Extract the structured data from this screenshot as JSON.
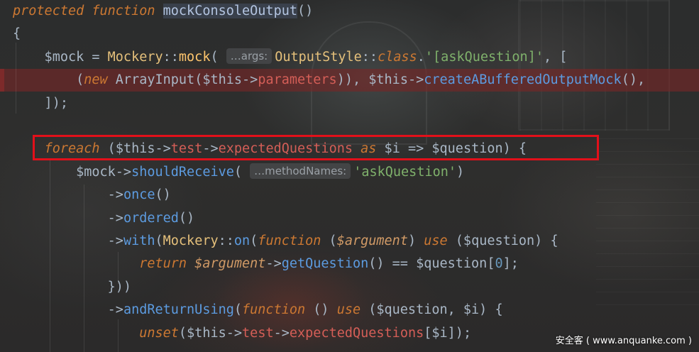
{
  "editor": {
    "lines": [
      {
        "tokens": [
          {
            "t": "protected",
            "c": "kw"
          },
          {
            "t": " ",
            "c": "plain"
          },
          {
            "t": "function",
            "c": "kw"
          },
          {
            "t": " ",
            "c": "plain"
          },
          {
            "t": "mockConsoleOutput",
            "c": "fnhl"
          },
          {
            "t": "()",
            "c": "plain"
          }
        ]
      },
      {
        "tokens": [
          {
            "t": "{",
            "c": "plain"
          }
        ]
      },
      {
        "tokens": [
          {
            "t": "    $mock = ",
            "c": "plain"
          },
          {
            "t": "Mockery",
            "c": "cls"
          },
          {
            "t": "::",
            "c": "plain"
          },
          {
            "t": "mock",
            "c": "fn"
          },
          {
            "t": "( ",
            "c": "plain"
          },
          {
            "t": "…args:",
            "c": "hint"
          },
          {
            "t": "OutputStyle",
            "c": "cls"
          },
          {
            "t": "::",
            "c": "plain"
          },
          {
            "t": "class",
            "c": "kw"
          },
          {
            "t": ".",
            "c": "plain"
          },
          {
            "t": "'[askQuestion]'",
            "c": "str"
          },
          {
            "t": ", [",
            "c": "plain"
          }
        ]
      },
      {
        "error": true,
        "tokens": [
          {
            "t": "        (",
            "c": "plain"
          },
          {
            "t": "new",
            "c": "kw"
          },
          {
            "t": " ArrayInput(",
            "c": "plain"
          },
          {
            "t": "$this",
            "c": "plain"
          },
          {
            "t": "->",
            "c": "plain"
          },
          {
            "t": "parameters",
            "c": "prop"
          },
          {
            "t": ")), ",
            "c": "plain"
          },
          {
            "t": "$this",
            "c": "plain"
          },
          {
            "t": "->",
            "c": "plain"
          },
          {
            "t": "createABufferedOutputMock",
            "c": "method"
          },
          {
            "t": "(),",
            "c": "plain"
          }
        ]
      },
      {
        "tokens": [
          {
            "t": "    ]);",
            "c": "plain"
          }
        ]
      },
      {
        "tokens": []
      },
      {
        "tokens": [
          {
            "t": "    ",
            "c": "plain"
          },
          {
            "t": "foreach",
            "c": "kw"
          },
          {
            "t": " (",
            "c": "plain"
          },
          {
            "t": "$this",
            "c": "plain"
          },
          {
            "t": "->",
            "c": "plain"
          },
          {
            "t": "test",
            "c": "prop"
          },
          {
            "t": "->",
            "c": "plain"
          },
          {
            "t": "expectedQuestions",
            "c": "prop"
          },
          {
            "t": " ",
            "c": "plain"
          },
          {
            "t": "as",
            "c": "kw"
          },
          {
            "t": " $i => $question) {",
            "c": "plain"
          }
        ]
      },
      {
        "tokens": [
          {
            "t": "        $mock->",
            "c": "plain"
          },
          {
            "t": "shouldReceive",
            "c": "method"
          },
          {
            "t": "( ",
            "c": "plain"
          },
          {
            "t": "…methodNames:",
            "c": "hint"
          },
          {
            "t": "'askQuestion'",
            "c": "str"
          },
          {
            "t": ")",
            "c": "plain"
          }
        ]
      },
      {
        "tokens": [
          {
            "t": "            ->",
            "c": "plain"
          },
          {
            "t": "once",
            "c": "method"
          },
          {
            "t": "()",
            "c": "plain"
          }
        ]
      },
      {
        "tokens": [
          {
            "t": "            ->",
            "c": "plain"
          },
          {
            "t": "ordered",
            "c": "method"
          },
          {
            "t": "()",
            "c": "plain"
          }
        ]
      },
      {
        "tokens": [
          {
            "t": "            ->",
            "c": "plain"
          },
          {
            "t": "with",
            "c": "method"
          },
          {
            "t": "(",
            "c": "plain"
          },
          {
            "t": "Mockery",
            "c": "cls"
          },
          {
            "t": "::",
            "c": "plain"
          },
          {
            "t": "on",
            "c": "method"
          },
          {
            "t": "(",
            "c": "plain"
          },
          {
            "t": "function",
            "c": "kw"
          },
          {
            "t": " (",
            "c": "plain"
          },
          {
            "t": "$argument",
            "c": "italicvar"
          },
          {
            "t": ") ",
            "c": "plain"
          },
          {
            "t": "use",
            "c": "kw"
          },
          {
            "t": " ($question) {",
            "c": "plain"
          }
        ]
      },
      {
        "tokens": [
          {
            "t": "                ",
            "c": "plain"
          },
          {
            "t": "return",
            "c": "kw"
          },
          {
            "t": " ",
            "c": "plain"
          },
          {
            "t": "$argument",
            "c": "italicvar"
          },
          {
            "t": "->",
            "c": "plain"
          },
          {
            "t": "getQuestion",
            "c": "method"
          },
          {
            "t": "() == $question[",
            "c": "plain"
          },
          {
            "t": "0",
            "c": "num"
          },
          {
            "t": "];",
            "c": "plain"
          }
        ]
      },
      {
        "tokens": [
          {
            "t": "            }))",
            "c": "plain"
          }
        ]
      },
      {
        "tokens": [
          {
            "t": "            ->",
            "c": "plain"
          },
          {
            "t": "andReturnUsing",
            "c": "method"
          },
          {
            "t": "(",
            "c": "plain"
          },
          {
            "t": "function",
            "c": "kw"
          },
          {
            "t": " () ",
            "c": "plain"
          },
          {
            "t": "use",
            "c": "kw"
          },
          {
            "t": " ($question, $i) {",
            "c": "plain"
          }
        ]
      },
      {
        "tokens": [
          {
            "t": "                ",
            "c": "plain"
          },
          {
            "t": "unset",
            "c": "kw"
          },
          {
            "t": "(",
            "c": "plain"
          },
          {
            "t": "$this",
            "c": "plain"
          },
          {
            "t": "->",
            "c": "plain"
          },
          {
            "t": "test",
            "c": "prop"
          },
          {
            "t": "->",
            "c": "plain"
          },
          {
            "t": "expectedQuestions",
            "c": "prop"
          },
          {
            "t": "[$i]);",
            "c": "plain"
          }
        ]
      }
    ]
  },
  "watermark": "安全客 ( www.anquanke.com )"
}
